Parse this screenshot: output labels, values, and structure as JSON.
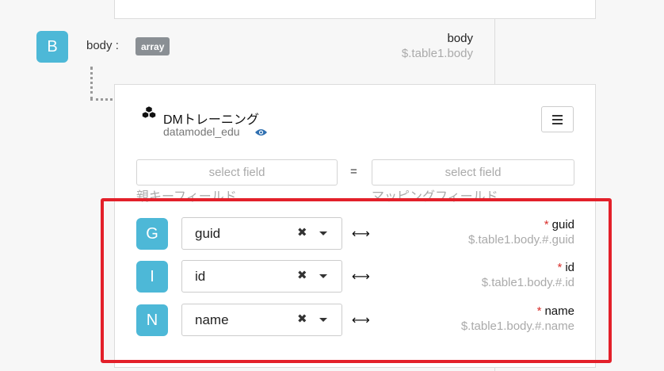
{
  "body_node": {
    "badge": "B",
    "label": "body :",
    "type_tag": "array",
    "name": "body",
    "path": "$.table1.body"
  },
  "model": {
    "icon": "cubes-icon",
    "title": "DMトレーニング",
    "subtitle": "datamodel_edu"
  },
  "key_mapping": {
    "left_placeholder": "select field",
    "right_placeholder": "select field",
    "operator": "=",
    "left_label": "親キーフィールド",
    "right_label": "マッピングフィールド"
  },
  "mappings": [
    {
      "badge": "G",
      "value": "guid",
      "clear": "✖",
      "arrow": "⟷",
      "required": "*",
      "name": "guid",
      "path": "$.table1.body.#.guid"
    },
    {
      "badge": "I",
      "value": "id",
      "clear": "✖",
      "arrow": "⟷",
      "required": "*",
      "name": "id",
      "path": "$.table1.body.#.id"
    },
    {
      "badge": "N",
      "value": "name",
      "clear": "✖",
      "arrow": "⟷",
      "required": "*",
      "name": "name",
      "path": "$.table1.body.#.name"
    }
  ],
  "colors": {
    "badge": "#4db8d7",
    "tag": "#8a8f94",
    "highlight": "#e3202a",
    "required": "#d9302c"
  }
}
